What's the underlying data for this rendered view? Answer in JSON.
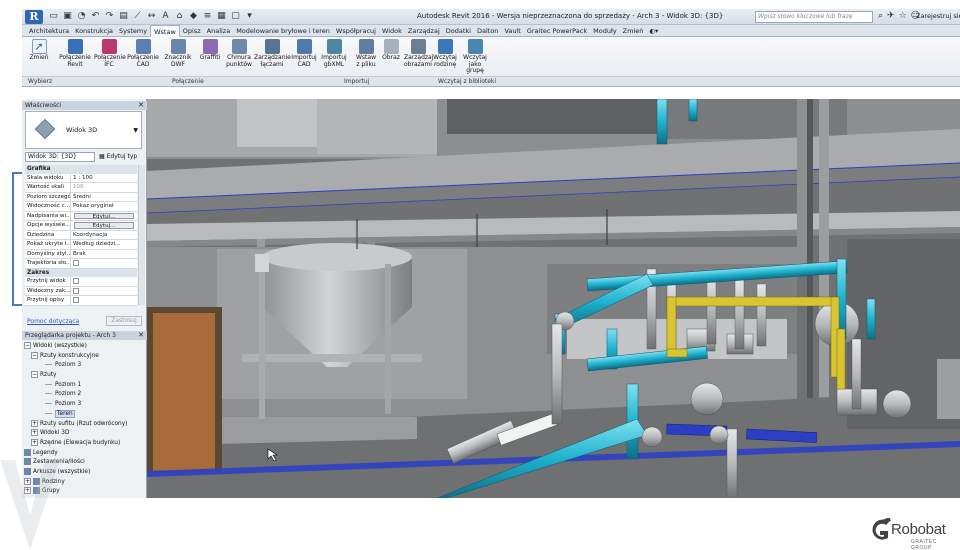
{
  "titlebar": {
    "app_letter": "R",
    "title": "Autodesk Revit 2016 - Wersja nieprzeznaczona do sprzedaży -   Arch 3 - Widok 3D: {3D}",
    "search_placeholder": "Wpisz słowo kluczowe lub frazę",
    "signin": "Zarejestruj się"
  },
  "tabs": [
    "Architektura",
    "Konstrukcja",
    "Systemy",
    "Wstaw",
    "Opisz",
    "Analiza",
    "Modelowanie bryłowe i teren",
    "Współpracuj",
    "Widok",
    "Zarządzaj",
    "Dodatki",
    "Dalton",
    "Vault",
    "Graitec PowerPack",
    "Moduły",
    "Zmień"
  ],
  "active_tab": "Wstaw",
  "ribbon": {
    "modify": "Zmień",
    "buttons": [
      {
        "label1": "Połączenie",
        "label2": "Revit",
        "color": "#3a6fb8"
      },
      {
        "label1": "Połączenie",
        "label2": "IFC",
        "color": "#b8386f"
      },
      {
        "label1": "Połączenie",
        "label2": "CAD",
        "color": "#5a7fb0"
      },
      {
        "label1": "Znacznik",
        "label2": "DWF",
        "color": "#6a86a8"
      },
      {
        "label1": "Graffiti",
        "label2": "",
        "color": "#8a6ab0"
      },
      {
        "label1": "Chmura",
        "label2": "punktów",
        "color": "#6f8aa8"
      },
      {
        "label1": "Zarządzanie",
        "label2": "łączami",
        "color": "#587594"
      },
      {
        "label1": "Importuj",
        "label2": "CAD",
        "color": "#4f78ad"
      },
      {
        "label1": "Importuj",
        "label2": "gbXML",
        "color": "#4b87a0"
      },
      {
        "label1": "Wstaw",
        "label2": "z pliku",
        "color": "#607ca0"
      },
      {
        "label1": "Obraz",
        "label2": "",
        "color": "#a7b1bd"
      },
      {
        "label1": "Zarządzaj",
        "label2": "obrazami",
        "color": "#6b7e94"
      },
      {
        "label1": "Wczytaj",
        "label2": "rodzinę",
        "color": "#3d77b9"
      },
      {
        "label1": "Wczytaj jako",
        "label2": "grupę",
        "color": "#4c85b0"
      }
    ],
    "panels": [
      "Wybierz",
      "Połączenie",
      "Importuj",
      "Wczytaj z biblioteki"
    ]
  },
  "properties": {
    "title": "Właściwości",
    "type_name": "Widok 3D",
    "view_dropdown": "Widok 3D: {3D}",
    "edit_type": "Edytuj typ",
    "groups": [
      {
        "name": "Grafika",
        "rows": [
          {
            "name": "Skala widoku",
            "value": "1 : 100",
            "kind": "text"
          },
          {
            "name": "Wartość skali",
            "value": "100",
            "kind": "gray"
          },
          {
            "name": "Poziom szczegół.",
            "value": "Średni",
            "kind": "text"
          },
          {
            "name": "Widoczność c...",
            "value": "Pokaz oryginał",
            "kind": "text"
          },
          {
            "name": "Nadpisania wi...",
            "value": "Edytuj...",
            "kind": "btn"
          },
          {
            "name": "Opcje wyświe...",
            "value": "Edytuj...",
            "kind": "btn"
          },
          {
            "name": "Dziedzina",
            "value": "Koordynacja",
            "kind": "text"
          },
          {
            "name": "Pokaż ukryte l...",
            "value": "Według dziedzi...",
            "kind": "text"
          },
          {
            "name": "Domyślny styl...",
            "value": "Brak",
            "kind": "text"
          },
          {
            "name": "Trajektoria sło...",
            "value": "",
            "kind": "chk"
          }
        ]
      },
      {
        "name": "Zakres",
        "rows": [
          {
            "name": "Przytnij widok",
            "value": "",
            "kind": "chk"
          },
          {
            "name": "Widoczny zak...",
            "value": "",
            "kind": "chk"
          },
          {
            "name": "Przytnij opisy",
            "value": "",
            "kind": "chk"
          }
        ]
      }
    ],
    "help_link": "Pomoc dotycząca",
    "apply": "Zastosuj"
  },
  "browser": {
    "title": "Przeglądarka projektu - Arch 3",
    "nodes": [
      {
        "label": "Widoki (wszystkie)",
        "indent": 0,
        "tw": "−"
      },
      {
        "label": "Rzuty konstrukcyjne",
        "indent": 1,
        "tw": "−"
      },
      {
        "label": "Poziom 3",
        "indent": 3,
        "tw": ""
      },
      {
        "label": "Rzuty",
        "indent": 1,
        "tw": "−"
      },
      {
        "label": "Poziom 1",
        "indent": 3,
        "tw": ""
      },
      {
        "label": "Poziom 2",
        "indent": 3,
        "tw": ""
      },
      {
        "label": "Poziom 3",
        "indent": 3,
        "tw": ""
      },
      {
        "label": "Teren",
        "indent": 3,
        "tw": "",
        "selected": true
      },
      {
        "label": "Rzuty sufitu (Rzut odwrócony)",
        "indent": 1,
        "tw": "+"
      },
      {
        "label": "Widoki 3D",
        "indent": 1,
        "tw": "+"
      },
      {
        "label": "Rzędne (Elewacja budynku)",
        "indent": 1,
        "tw": "+"
      },
      {
        "label": "Legendy",
        "indent": 0,
        "tw": "",
        "box": true
      },
      {
        "label": "Zestawienia/Ilości",
        "indent": 0,
        "tw": "",
        "box": true
      },
      {
        "label": "Arkusze (wszystkie)",
        "indent": 0,
        "tw": "",
        "box": true
      },
      {
        "label": "Rodziny",
        "indent": 0,
        "tw": "+",
        "box": true
      },
      {
        "label": "Grupy",
        "indent": 0,
        "tw": "+",
        "box": true
      }
    ]
  },
  "colors": {
    "pipe_cyan": "#1fb2cf",
    "pipe_yellow": "#d8c531",
    "pipe_blue": "#2c3fc4",
    "door": "#a86b3a",
    "accent": "#2f66b3"
  },
  "logo": {
    "word": "Robobat",
    "sub": "GRAITEC GROUP"
  }
}
